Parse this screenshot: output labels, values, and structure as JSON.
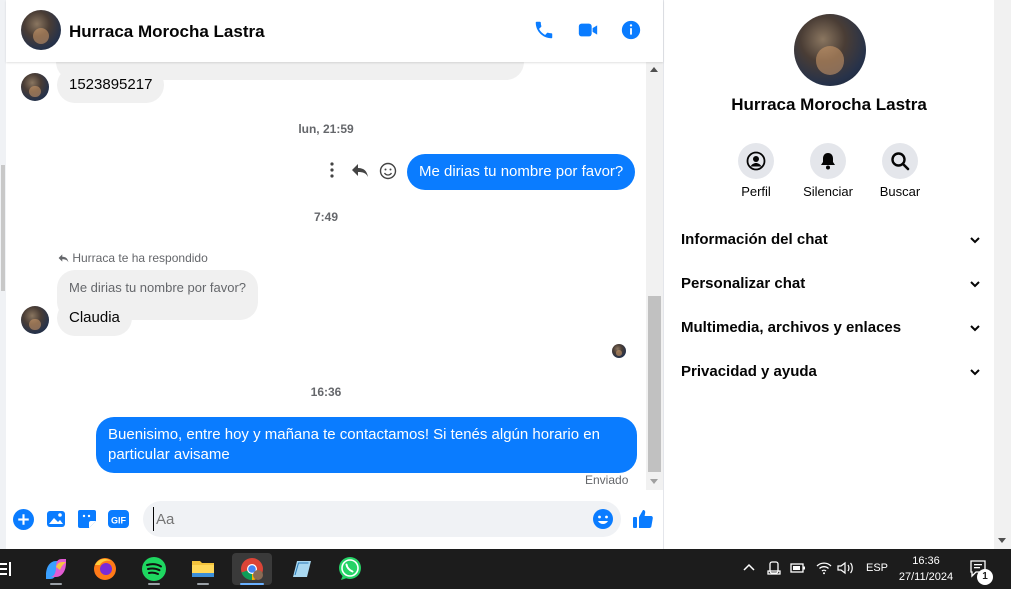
{
  "chat": {
    "contact_name": "Hurraca Morocha Lastra",
    "icons": {
      "call": "phone-icon",
      "video": "video-camera-icon",
      "info": "info-icon"
    },
    "messages": [
      {
        "kind": "incoming",
        "text": "1523895217"
      },
      {
        "kind": "timestamp",
        "text": "lun, 21:59"
      },
      {
        "kind": "outgoing",
        "text": "Me dirias tu nombre por favor?"
      },
      {
        "kind": "timestamp",
        "text": "7:49"
      },
      {
        "kind": "reply_note",
        "text": "Hurraca te ha respondido"
      },
      {
        "kind": "quoted",
        "text": "Me dirias tu nombre por favor?"
      },
      {
        "kind": "incoming",
        "text": "Claudia"
      },
      {
        "kind": "timestamp",
        "text": "16:36"
      },
      {
        "kind": "outgoing",
        "text": "Buenisimo, entre hoy y mañana te contactamos! Si tenés algún horario en particular avisame"
      },
      {
        "kind": "status",
        "text": "Enviado"
      }
    ],
    "composer": {
      "placeholder": "Aa",
      "icons": [
        "plus-circle-icon",
        "image-icon",
        "sticker-icon",
        "gif-icon",
        "emoji-icon",
        "like-icon"
      ]
    }
  },
  "info_panel": {
    "name": "Hurraca Morocha Lastra",
    "actions": [
      {
        "label": "Perfil",
        "icon": "profile-icon"
      },
      {
        "label": "Silenciar",
        "icon": "bell-icon"
      },
      {
        "label": "Buscar",
        "icon": "search-icon"
      }
    ],
    "sections": [
      {
        "label": "Información del chat"
      },
      {
        "label": "Personalizar chat"
      },
      {
        "label": "Multimedia, archivos y enlaces"
      },
      {
        "label": "Privacidad y ayuda"
      }
    ]
  },
  "taskbar": {
    "apps": [
      "copilot-icon",
      "firefox-icon",
      "spotify-icon",
      "file-explorer-icon",
      "chrome-icon",
      "notes-icon",
      "whatsapp-icon"
    ],
    "active_app": "chrome-icon",
    "language": "ESP",
    "time": "16:36",
    "date": "27/11/2024",
    "notification_count": "1"
  },
  "colors": {
    "accent": "#0a7cff",
    "incoming_bubble": "#f0f0f0",
    "taskbar": "#1c1c1c"
  }
}
